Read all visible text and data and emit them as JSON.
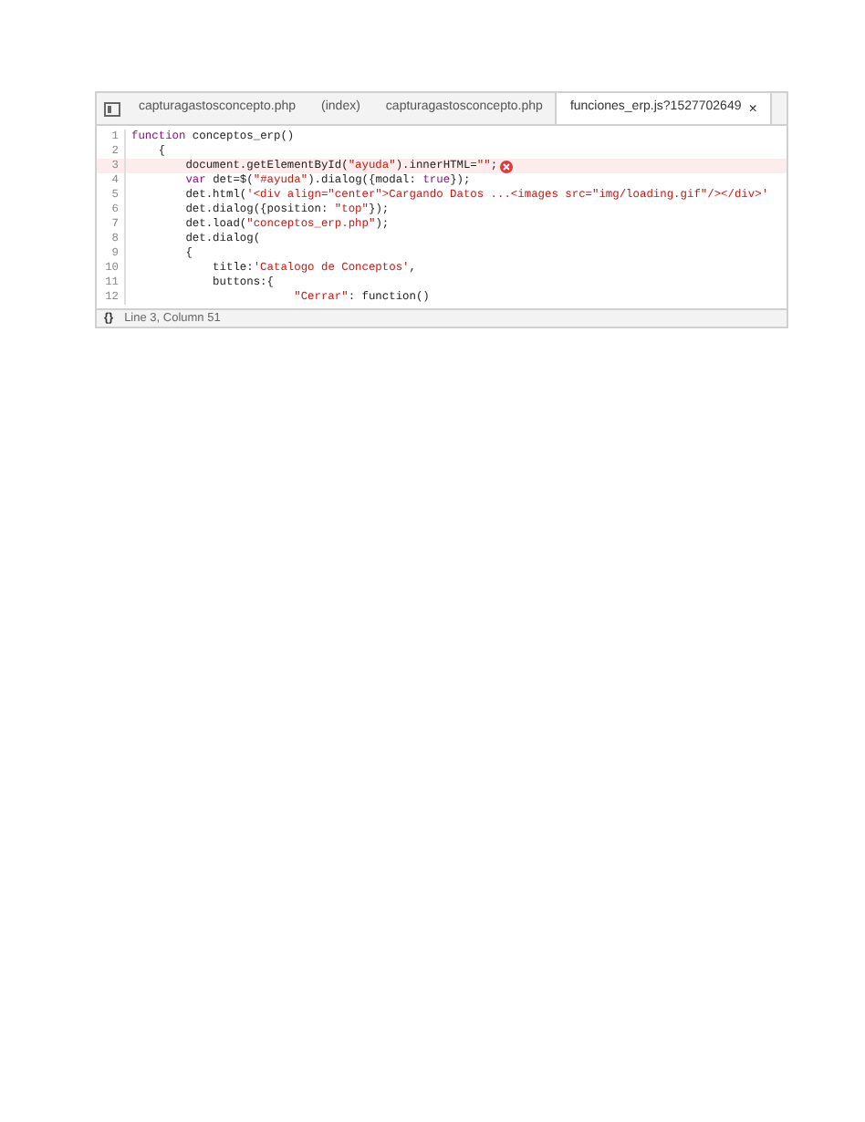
{
  "tabs": [
    {
      "label": "capturagastosconcepto.php",
      "selected": false,
      "closable": false
    },
    {
      "label": "(index)",
      "selected": false,
      "closable": false
    },
    {
      "label": "capturagastosconcepto.php",
      "selected": false,
      "closable": false
    },
    {
      "label": "funciones_erp.js?1527702649",
      "selected": true,
      "closable": true,
      "close": "×"
    }
  ],
  "code_lines": [
    {
      "number": "1",
      "error": false,
      "tokens": [
        {
          "kind": "keyword",
          "text": "function"
        },
        {
          "kind": "plain",
          "text": " conceptos_erp()"
        }
      ]
    },
    {
      "number": "2",
      "error": false,
      "tokens": [
        {
          "kind": "plain",
          "text": "    {"
        }
      ]
    },
    {
      "number": "3",
      "error": true,
      "tokens": [
        {
          "kind": "plain",
          "text": "        document.getElementById("
        },
        {
          "kind": "string",
          "text": "\"ayuda\""
        },
        {
          "kind": "plain",
          "text": ").innerHTML="
        },
        {
          "kind": "string",
          "text": "\"\""
        },
        {
          "kind": "plain",
          "text": ";"
        }
      ]
    },
    {
      "number": "4",
      "error": false,
      "tokens": [
        {
          "kind": "keyword",
          "text": "        var"
        },
        {
          "kind": "plain",
          "text": " det=$("
        },
        {
          "kind": "string",
          "text": "\"#ayuda\""
        },
        {
          "kind": "plain",
          "text": ").dialog({modal: "
        },
        {
          "kind": "keyword",
          "text": "true"
        },
        {
          "kind": "plain",
          "text": "});"
        }
      ]
    },
    {
      "number": "5",
      "error": false,
      "tokens": [
        {
          "kind": "plain",
          "text": "        det.html("
        },
        {
          "kind": "string",
          "text": "'<div align=\"center\">Cargando Datos ...<images src=\"img/loading.gif\"/></div>'"
        }
      ]
    },
    {
      "number": "6",
      "error": false,
      "tokens": [
        {
          "kind": "plain",
          "text": "        det.dialog({position: "
        },
        {
          "kind": "string",
          "text": "\"top\""
        },
        {
          "kind": "plain",
          "text": "});"
        }
      ]
    },
    {
      "number": "7",
      "error": false,
      "tokens": [
        {
          "kind": "plain",
          "text": "        det.load("
        },
        {
          "kind": "string",
          "text": "\"conceptos_erp.php\""
        },
        {
          "kind": "plain",
          "text": ");"
        }
      ]
    },
    {
      "number": "8",
      "error": false,
      "tokens": [
        {
          "kind": "plain",
          "text": "        det.dialog("
        }
      ]
    },
    {
      "number": "9",
      "error": false,
      "tokens": [
        {
          "kind": "plain",
          "text": "        {"
        }
      ]
    },
    {
      "number": "10",
      "error": false,
      "tokens": [
        {
          "kind": "plain",
          "text": "            title:"
        },
        {
          "kind": "string",
          "text": "'Catalogo de Conceptos'"
        },
        {
          "kind": "plain",
          "text": ","
        }
      ]
    },
    {
      "number": "11",
      "error": false,
      "tokens": [
        {
          "kind": "plain",
          "text": "            buttons:{"
        }
      ]
    },
    {
      "number": "12",
      "error": false,
      "tokens": [
        {
          "kind": "string",
          "text": "                        \"Cerrar\""
        },
        {
          "kind": "plain",
          "text": ": function()"
        }
      ]
    }
  ],
  "status_bar": {
    "icon": "{}",
    "text": "Line 3, Column 51"
  }
}
